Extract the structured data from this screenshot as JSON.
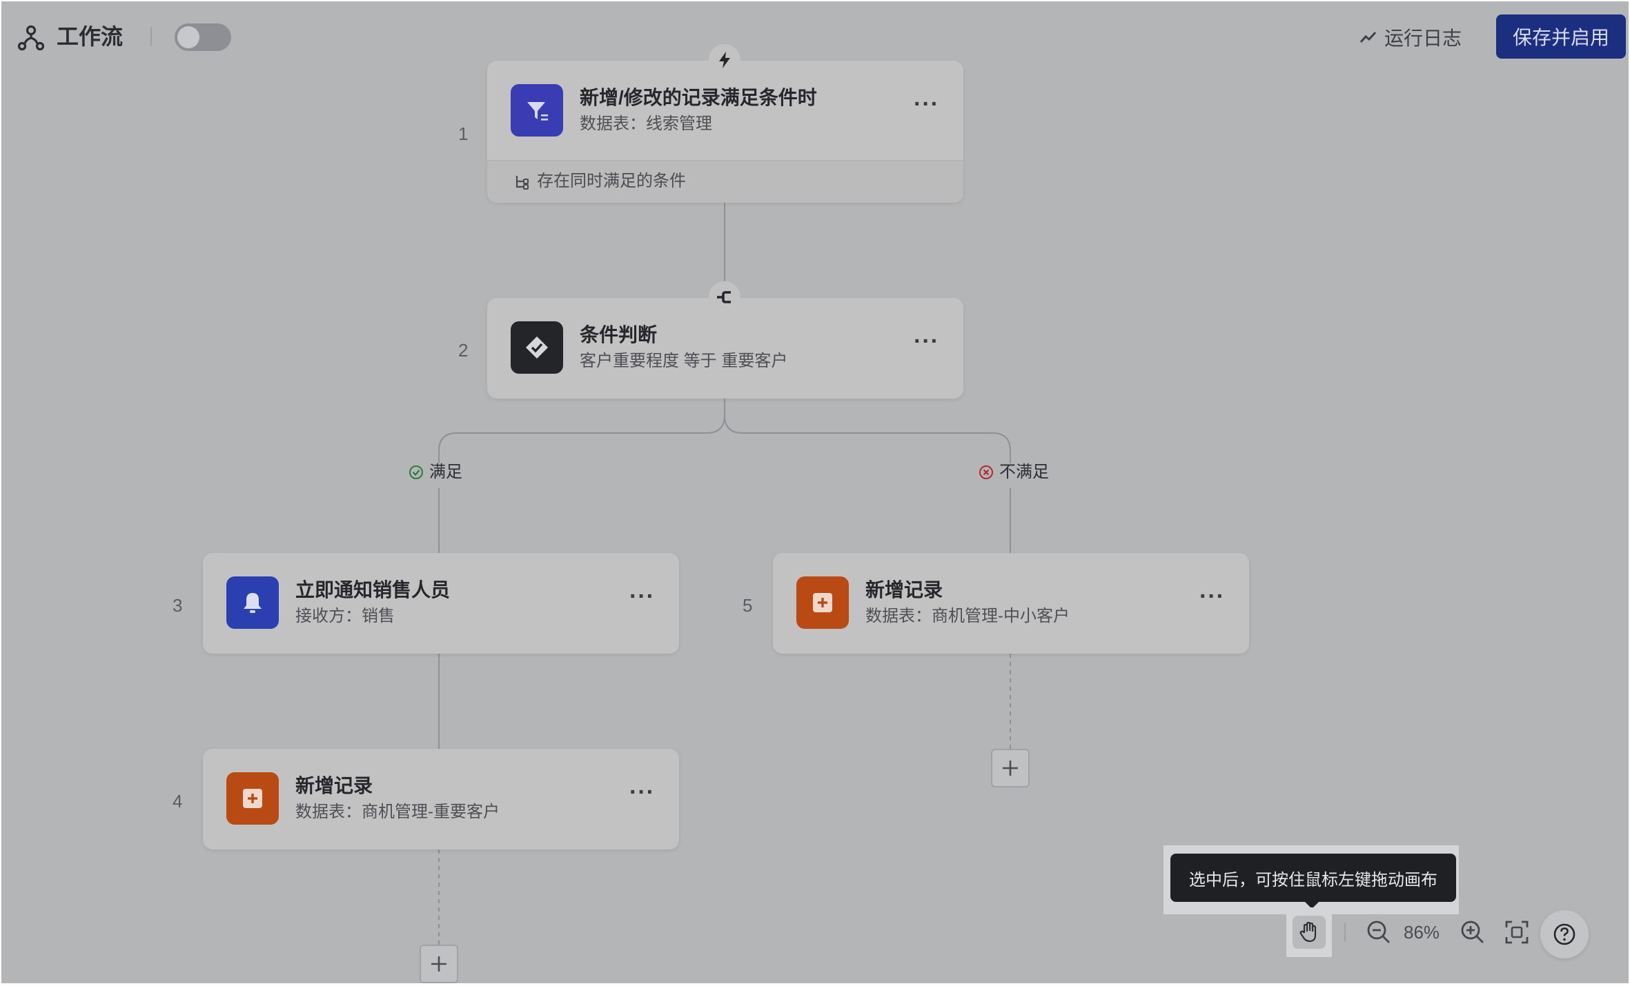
{
  "header": {
    "title": "工作流",
    "run_log_label": "运行日志",
    "save_enable_label": "保存并启用",
    "toggle_on": false
  },
  "nodes": [
    {
      "step": "1",
      "title": "新增/修改的记录满足条件时",
      "subtitle": "数据表：线索管理",
      "footer": "存在同时满足的条件",
      "icon": "filter-icon",
      "color": "#3a3cb4"
    },
    {
      "step": "2",
      "title": "条件判断",
      "subtitle": "客户重要程度 等于 重要客户",
      "icon": "check-badge-icon",
      "color": "#242528"
    },
    {
      "step": "3",
      "title": "立即通知销售人员",
      "subtitle": "接收方：销售",
      "icon": "bell-icon",
      "color": "#2b3fb0"
    },
    {
      "step": "4",
      "title": "新增记录",
      "subtitle": "数据表：商机管理-重要客户",
      "icon": "add-record-icon",
      "color": "#b94a14"
    },
    {
      "step": "5",
      "title": "新增记录",
      "subtitle": "数据表：商机管理-中小客户",
      "icon": "add-record-icon",
      "color": "#b94a14"
    }
  ],
  "branches": {
    "yes_label": "满足",
    "no_label": "不满足"
  },
  "canvas_controls": {
    "tooltip": "选中后，可按住鼠标左键拖动画布",
    "zoom": "86%"
  }
}
